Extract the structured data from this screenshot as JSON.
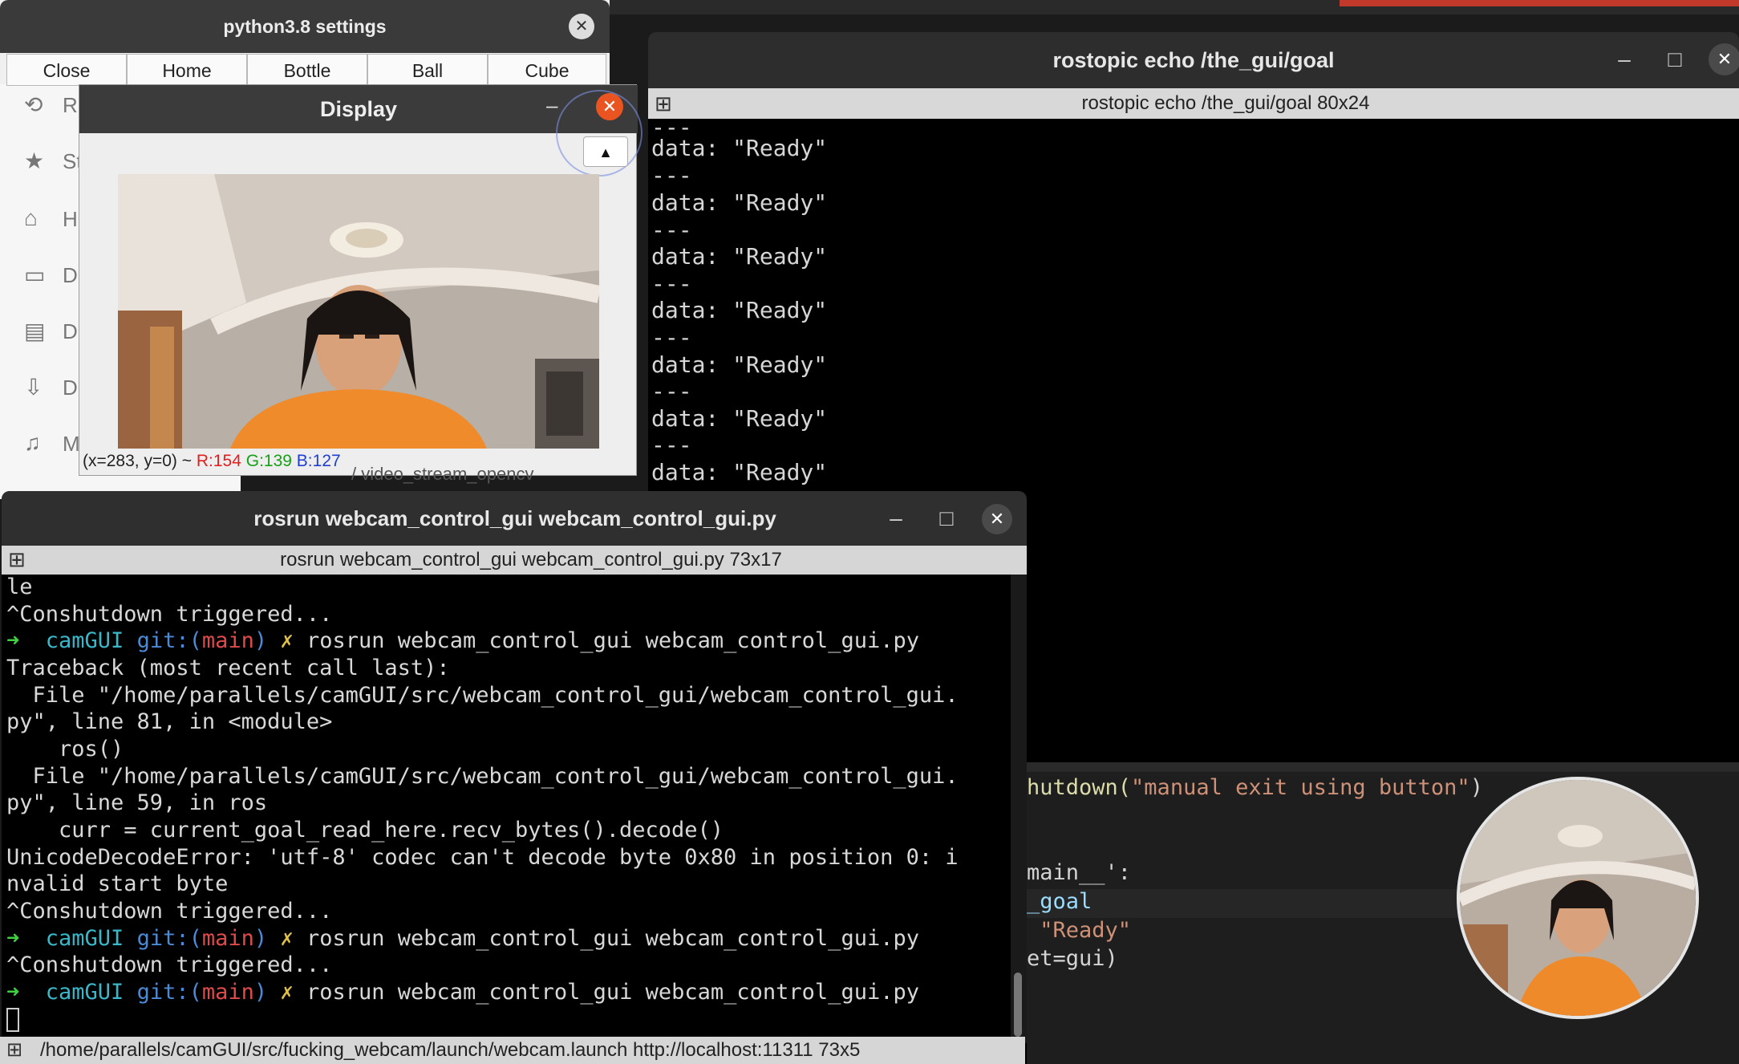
{
  "rostopic_window": {
    "title": "rostopic echo /the_gui/goal",
    "tab_label": "rostopic echo /the_gui/goal 80x24",
    "minimize_symbol": "–",
    "maximize_symbol": "□",
    "close_symbol": "✕",
    "terminal_lines": [
      "---",
      "data: \"Ready\"",
      "---",
      "data: \"Ready\"",
      "---",
      "data: \"Ready\"",
      "---",
      "data: \"Ready\"",
      "---",
      "data: \"Ready\"",
      "---",
      "data: \"Ready\"",
      "---",
      "data: \"Ready\""
    ]
  },
  "editor": {
    "line1_prefix": "hutdown(",
    "line1_string": "\"manual exit using button\"",
    "line1_suffix": ")",
    "line2": "main__':",
    "line3": "_goal",
    "line4": " \"Ready\"",
    "line5": "et=gui)"
  },
  "file_manager": {
    "items": [
      {
        "icon": "⟲",
        "label": "R"
      },
      {
        "icon": "★",
        "label": "St"
      },
      {
        "icon": "⌂",
        "label": "H"
      },
      {
        "icon": "▭",
        "label": "D"
      },
      {
        "icon": "▤",
        "label": "D"
      },
      {
        "icon": "⇩",
        "label": "D"
      },
      {
        "icon": "♫",
        "label": "M"
      }
    ]
  },
  "settings_window": {
    "title": "python3.8 settings",
    "close_symbol": "✕",
    "buttons": [
      "Close",
      "Home",
      "Bottle",
      "Ball",
      "Cube"
    ]
  },
  "display_window": {
    "title": "Display",
    "minimize_symbol": "–",
    "close_symbol": "✕",
    "pointer_symbol": "▲",
    "status_coords": "(x=283, y=0) ~ ",
    "status_r": "R:154",
    "status_g": "G:139",
    "status_b": "B:127"
  },
  "rosrun_window": {
    "title": "rosrun webcam_control_gui webcam_control_gui.py",
    "tab_label": "rosrun webcam_control_gui webcam_control_gui.py 73x17",
    "minimize_symbol": "–",
    "maximize_symbol": "□",
    "close_symbol": "✕",
    "prompt_arrow": "➜",
    "prompt_dir": "camGUI",
    "prompt_git": "git:(",
    "prompt_branch": "main",
    "prompt_git_close": ")",
    "prompt_x": "✗",
    "command": "rosrun webcam_control_gui webcam_control_gui.py",
    "line_le": "le",
    "line_shutdown": "^Conshutdown triggered...",
    "line_traceback": "Traceback (most recent call last):",
    "line_file1": "  File \"/home/parallels/camGUI/src/webcam_control_gui/webcam_control_gui.",
    "line_py1": "py\", line 81, in <module>",
    "line_ros": "    ros()",
    "line_file2": "  File \"/home/parallels/camGUI/src/webcam_control_gui/webcam_control_gui.",
    "line_py2": "py\", line 59, in ros",
    "line_curr": "    curr = current_goal_read_here.recv_bytes().decode()",
    "line_err1": "UnicodeDecodeError: 'utf-8' codec can't decode byte 0x80 in position 0: i",
    "line_err2": "nvalid start byte",
    "bottom_tab": "/home/parallels/camGUI/src/fucking_webcam/launch/webcam.launch http://localhost:11311 73x5"
  },
  "overlay_text": "/ video_stream_opencv"
}
